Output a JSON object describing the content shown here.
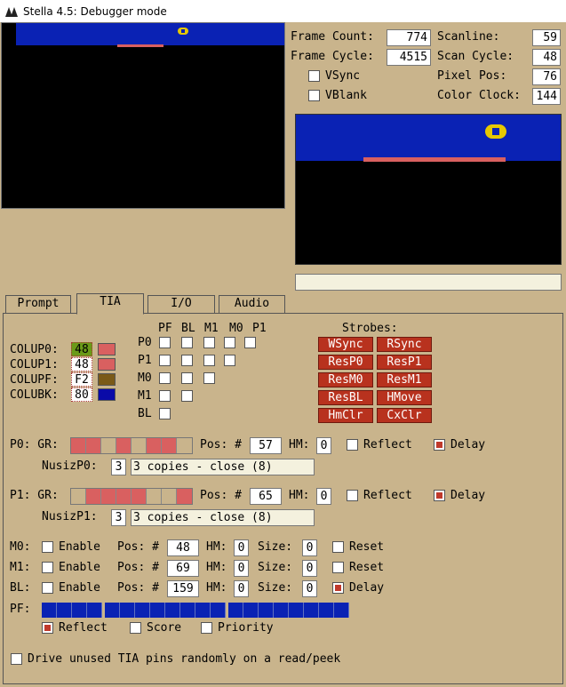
{
  "title": "Stella 4.5: Debugger mode",
  "colors": {
    "tia_blue": "#0a22b4",
    "red": "#c0392b",
    "playfield": "#0a22b4"
  },
  "top_info": {
    "frame_count_label": "Frame Count:",
    "frame_count": "774",
    "frame_cycle_label": "Frame Cycle:",
    "frame_cycle": "4515",
    "vsync_label": "VSync",
    "vblank_label": "VBlank",
    "scanline_label": "Scanline:",
    "scanline": "59",
    "scan_cycle_label": "Scan Cycle:",
    "scan_cycle": "48",
    "pixel_pos_label": "Pixel Pos:",
    "pixel_pos": "76",
    "color_clock_label": "Color Clock:",
    "color_clock": "144"
  },
  "tabs": [
    "Prompt",
    "TIA",
    "I/O",
    "Audio"
  ],
  "colors_section": [
    {
      "label": "COLUP0:",
      "value": "48",
      "color": "#d96060"
    },
    {
      "label": "COLUP1:",
      "value": "48",
      "color": "#d96060"
    },
    {
      "label": "COLUPF:",
      "value": "F2",
      "color": "#7a5a18"
    },
    {
      "label": "COLUBK:",
      "value": "80",
      "color": "#0a0aa8"
    }
  ],
  "collision": {
    "cols": [
      "PF",
      "BL",
      "M1",
      "M0",
      "P1"
    ],
    "rows": [
      "P0",
      "P1",
      "M0",
      "M1",
      "BL"
    ]
  },
  "strobes_label": "Strobes:",
  "strobes": [
    "WSync",
    "RSync",
    "ResP0",
    "ResP1",
    "ResM0",
    "ResM1",
    "ResBL",
    "HMove",
    "HmClr",
    "CxClr"
  ],
  "p0": {
    "label": "P0: GR:",
    "pos_label": "Pos: #",
    "pos": "57",
    "hm_label": "HM:",
    "hm": "0",
    "reflect_label": "Reflect",
    "delay_label": "Delay",
    "nusiz_label": "NusizP0:",
    "nusiz": "3",
    "nusiz_desc": "3 copies - close (8)",
    "gr": [
      1,
      1,
      0,
      1,
      0,
      1,
      1,
      0
    ]
  },
  "p1": {
    "label": "P1: GR:",
    "pos_label": "Pos: #",
    "pos": "65",
    "hm_label": "HM:",
    "hm": "0",
    "reflect_label": "Reflect",
    "delay_label": "Delay",
    "nusiz_label": "NusizP1:",
    "nusiz": "3",
    "nusiz_desc": "3 copies - close (8)",
    "gr": [
      0,
      1,
      1,
      1,
      1,
      0,
      0,
      1
    ]
  },
  "missiles": [
    {
      "label": "M0:",
      "enable": "Enable",
      "pos_label": "Pos: #",
      "pos": "48",
      "hm_label": "HM:",
      "hm": "0",
      "size_label": "Size:",
      "size": "0",
      "extra_label": "Reset",
      "extra_on": false
    },
    {
      "label": "M1:",
      "enable": "Enable",
      "pos_label": "Pos: #",
      "pos": "69",
      "hm_label": "HM:",
      "hm": "0",
      "size_label": "Size:",
      "size": "0",
      "extra_label": "Reset",
      "extra_on": false
    },
    {
      "label": "BL:",
      "enable": "Enable",
      "pos_label": "Pos: #",
      "pos": "159",
      "hm_label": "HM:",
      "hm": "0",
      "size_label": "Size:",
      "size": "0",
      "extra_label": "Delay",
      "extra_on": true
    }
  ],
  "pf_label": "PF:",
  "pf_options": {
    "reflect": "Reflect",
    "score": "Score",
    "priority": "Priority"
  },
  "drive_unused": "Drive unused TIA pins randomly on a read/peek"
}
